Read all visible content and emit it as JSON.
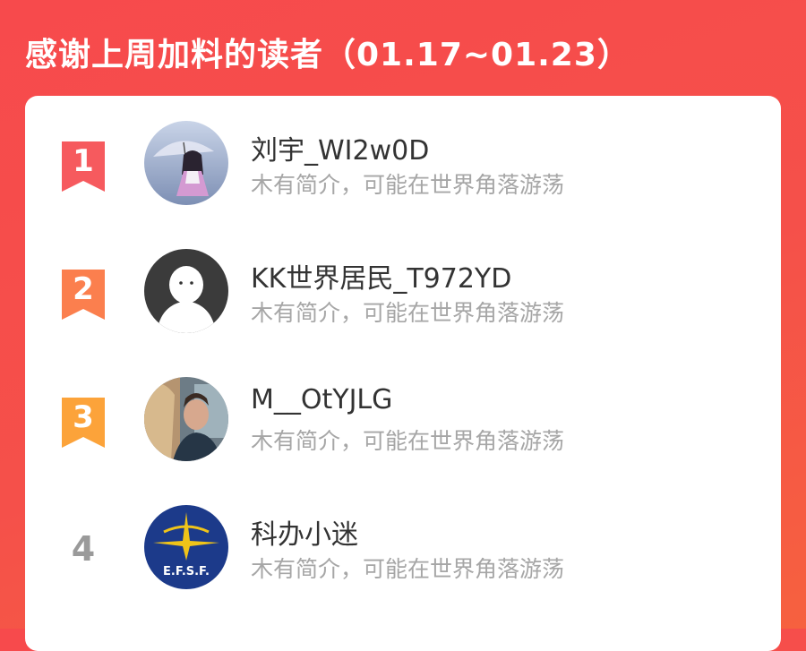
{
  "header": {
    "title": "感谢上周加料的读者（01.17~01.23）"
  },
  "colors": {
    "rank1": "#f65a5e",
    "rank2": "#fb7f4e",
    "rank3": "#fca33a",
    "rank_plain": "#9a9a9a"
  },
  "readers": [
    {
      "rank": "1",
      "name": "刘宇_WI2w0D",
      "bio": "木有简介，可能在世界角落游荡",
      "avatar_icon": "anime-girl-umbrella-avatar"
    },
    {
      "rank": "2",
      "name": "KK世界居民_T972YD",
      "bio": "木有简介，可能在世界角落游荡",
      "avatar_icon": "default-user-avatar"
    },
    {
      "rank": "3",
      "name": "M__OtYJLG",
      "bio": "木有简介，可能在世界角落游荡",
      "avatar_icon": "movie-still-avatar"
    },
    {
      "rank": "4",
      "name": "科办小迷",
      "bio": "木有简介，可能在世界角落游荡",
      "avatar_icon": "efsf-logo-avatar",
      "avatar_text": "E.F.S.F."
    }
  ]
}
